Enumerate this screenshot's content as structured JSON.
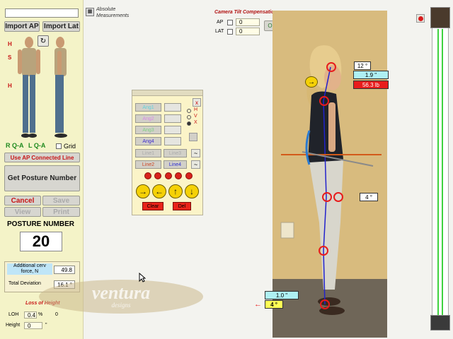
{
  "left_panel": {
    "name_field": "",
    "import_ap": "Import AP",
    "import_lat": "Import Lat",
    "marker_labels": [
      "H",
      "S",
      "H"
    ],
    "rqa": "R Q-A",
    "lqa": "L Q-A",
    "grid_label": "Grid",
    "use_ap_line": "Use AP Connected Line",
    "get_posture": "Get Posture Number",
    "cancel": "Cancel",
    "save": "Save",
    "view": "View",
    "print": "Print",
    "posture_label": "POSTURE NUMBER",
    "posture_value": "20",
    "additional_label": "Additional cerv force, N",
    "additional_value": "49.8",
    "total_dev_label": "Total Deviation",
    "total_dev_value": "16.1 °",
    "loss_height_label": "Loss of Height",
    "loh_label": "LOH",
    "loh_value": "0.4",
    "loh_unit": "%",
    "loh_value2": "0",
    "height_label": "Height",
    "height_value": "0",
    "height_unit": "\""
  },
  "absolute": {
    "line1": "Absolute",
    "line2": "Measurements"
  },
  "camera": {
    "title": "Camera Tilt Compensation",
    "ap_label": "AP",
    "ap_value": "0",
    "lat_label": "LAT",
    "lat_value": "0",
    "ok": "Ok"
  },
  "angle_panel": {
    "ang_buttons": [
      "Ang1",
      "Ang2",
      "Ang3",
      "Ang4"
    ],
    "ang_colors": [
      "#5fd3dc",
      "#d989e8",
      "#7fd080",
      "#3b2ad0"
    ],
    "close": "x",
    "radio_labels": [
      "H",
      "V",
      "X"
    ],
    "line1": "Line1",
    "line3": "Line3",
    "line2": "Line2",
    "line4": "Line4",
    "clear": "Clear",
    "del": "Del"
  },
  "photo": {
    "head_angle": "12 °",
    "forward_in": "1.9 \"",
    "force": "56.3 lb",
    "mid_angle": "4 °",
    "bottom_in": "1.0 \"",
    "bottom_angle": "4 °"
  },
  "logo": {
    "text": "ventura",
    "sub": "designs"
  }
}
